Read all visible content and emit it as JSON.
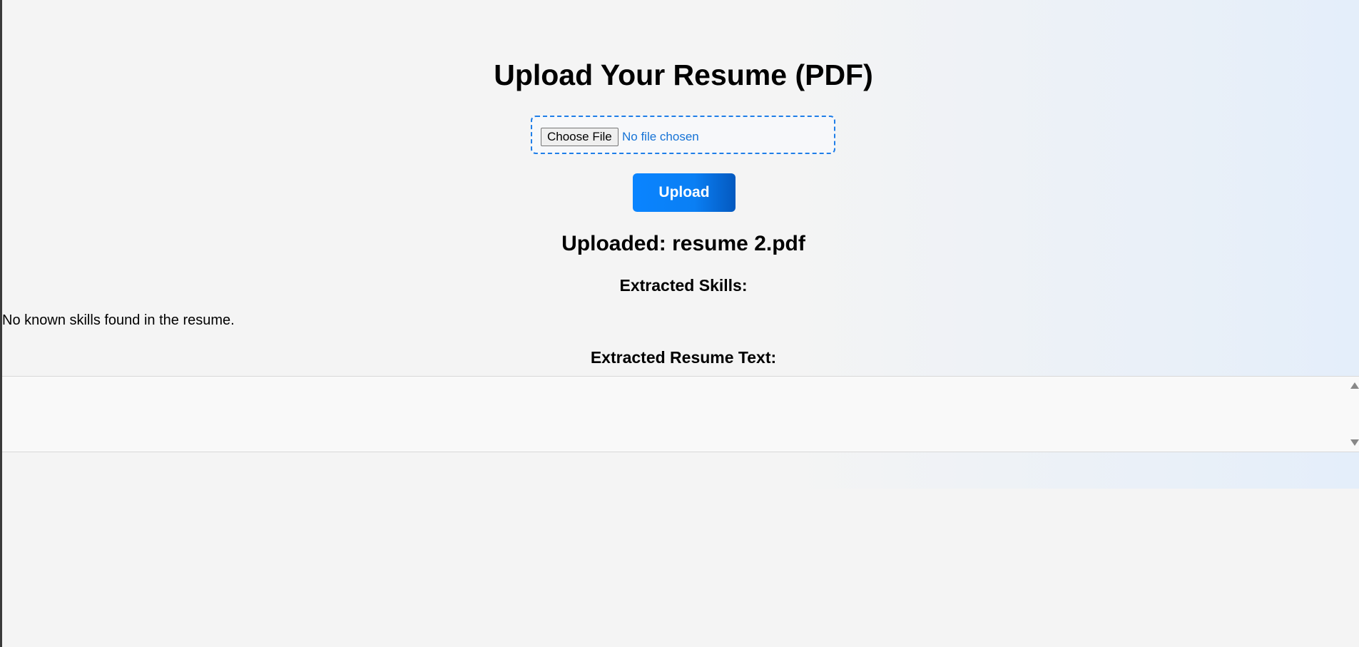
{
  "page": {
    "title": "Upload Your Resume (PDF)"
  },
  "file_input": {
    "button_label": "Choose File",
    "status": "No file chosen"
  },
  "upload_button": {
    "label": "Upload"
  },
  "result": {
    "uploaded_label": "Uploaded: resume 2.pdf",
    "skills_heading": "Extracted Skills:",
    "skills_message": "No known skills found in the resume.",
    "text_heading": "Extracted Resume Text:",
    "text_content": ""
  },
  "colors": {
    "accent": "#0a84ff",
    "dashed_border": "#1f7ee8",
    "file_status_text": "#1673d6",
    "background": "#f4f4f4"
  }
}
